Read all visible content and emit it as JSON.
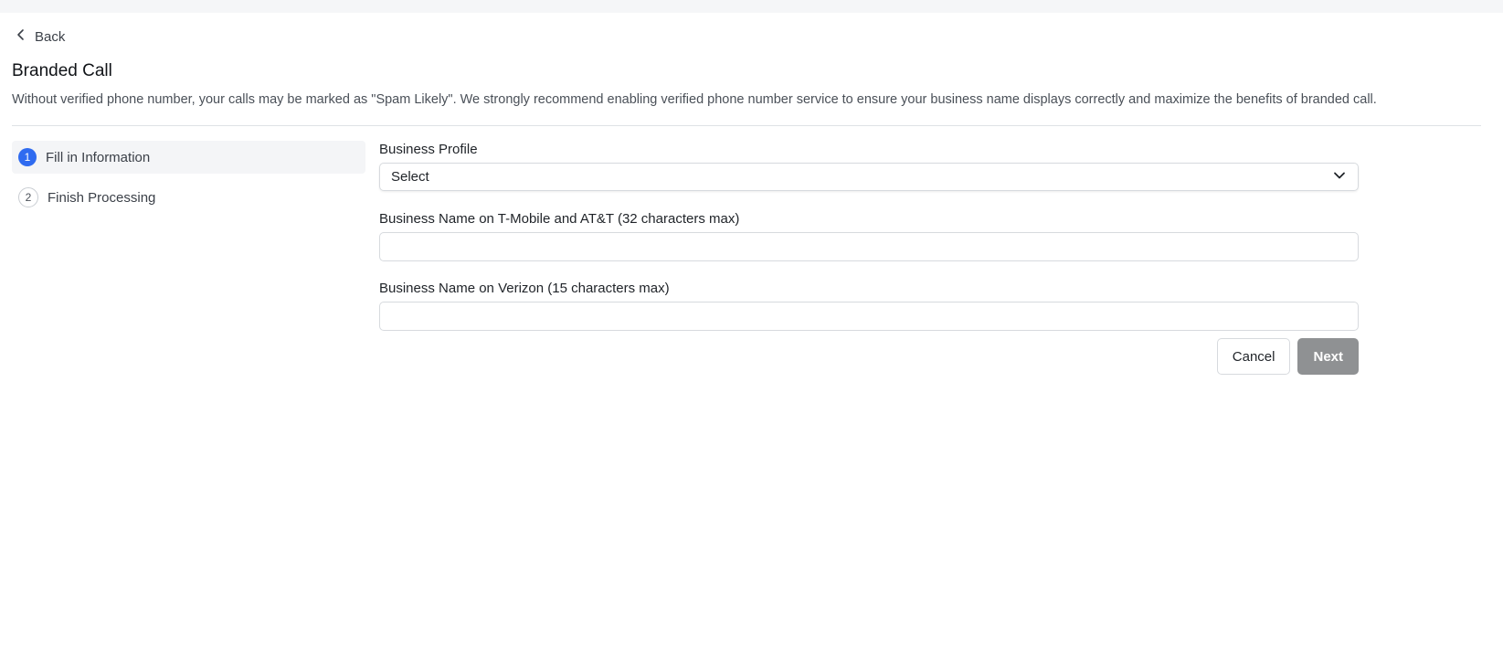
{
  "nav": {
    "back_label": "Back",
    "back_icon": "chevron-left-icon"
  },
  "page": {
    "title": "Branded Call",
    "description": "Without verified phone number, your calls may be marked as \"Spam Likely\". We strongly recommend enabling verified phone number service to ensure your business name displays correctly and maximize the benefits of branded call."
  },
  "steps": [
    {
      "number": "1",
      "label": "Fill in Information",
      "active": true
    },
    {
      "number": "2",
      "label": "Finish Processing",
      "active": false
    }
  ],
  "form": {
    "business_profile": {
      "label": "Business Profile",
      "value": "Select"
    },
    "tmobile_name": {
      "label": "Business Name on T-Mobile and AT&T (32 characters max)",
      "value": ""
    },
    "verizon_name": {
      "label": "Business Name on Verizon (15 characters max)",
      "value": ""
    }
  },
  "actions": {
    "cancel_label": "Cancel",
    "next_label": "Next"
  },
  "colors": {
    "accent": "#2f6bf0",
    "disabled_button": "#8f9193"
  }
}
